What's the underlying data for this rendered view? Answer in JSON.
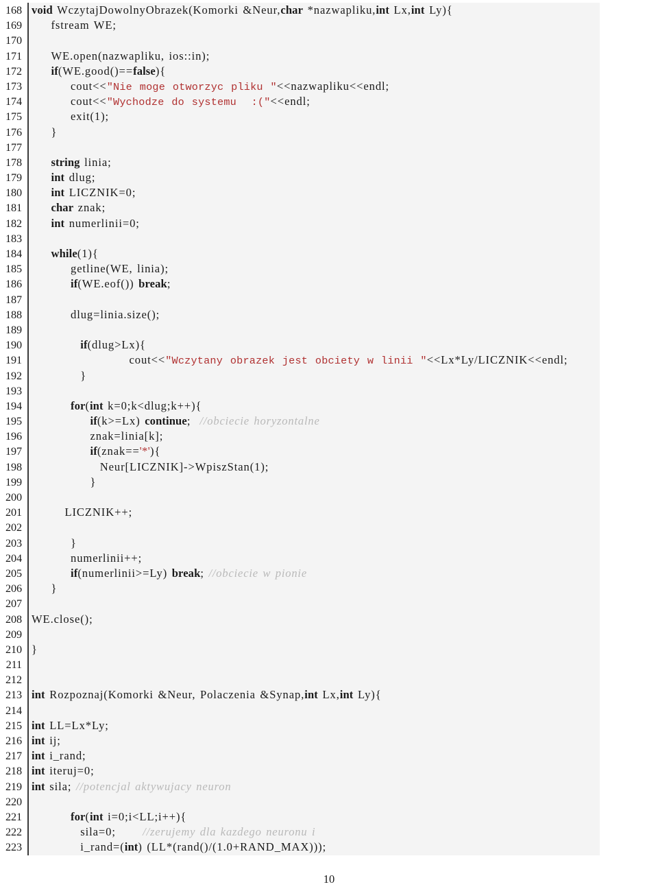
{
  "document": {
    "type": "code-listing",
    "language": "C++",
    "page_number": "10",
    "first_line_number": 168,
    "last_line_number": 223,
    "colors": {
      "background": "#f4f4f4",
      "text": "#1a1a1a",
      "string": "#b03030",
      "comment": "#b9b9b9",
      "rule": "#3a3a3a"
    }
  },
  "lines": [
    {
      "n": "168",
      "indent": 0,
      "tokens": [
        {
          "t": "kw",
          "v": "void"
        },
        {
          "t": "id",
          "v": " WczytajDowolnyObrazek(Komorki &Neur,"
        },
        {
          "t": "kw",
          "v": "char"
        },
        {
          "t": "id",
          "v": " *nazwapliku,"
        },
        {
          "t": "kw",
          "v": "int"
        },
        {
          "t": "id",
          "v": " Lx,"
        },
        {
          "t": "kw",
          "v": "int"
        },
        {
          "t": "id",
          "v": " Ly){"
        }
      ]
    },
    {
      "n": "169",
      "indent": 1,
      "tokens": [
        {
          "t": "id",
          "v": "fstream WE;"
        }
      ]
    },
    {
      "n": "170",
      "indent": 0,
      "tokens": []
    },
    {
      "n": "171",
      "indent": 1,
      "tokens": [
        {
          "t": "id",
          "v": "WE.open(nazwapliku, ios::in);"
        }
      ]
    },
    {
      "n": "172",
      "indent": 1,
      "tokens": [
        {
          "t": "kw",
          "v": "if"
        },
        {
          "t": "id",
          "v": "(WE.good()=="
        },
        {
          "t": "kw",
          "v": "false"
        },
        {
          "t": "id",
          "v": "){"
        }
      ]
    },
    {
      "n": "173",
      "indent": 2,
      "tokens": [
        {
          "t": "id",
          "v": "cout<<"
        },
        {
          "t": "str",
          "v": "\"Nie moge otworzyc pliku \""
        },
        {
          "t": "id",
          "v": "<<nazwapliku<<endl;"
        }
      ]
    },
    {
      "n": "174",
      "indent": 2,
      "tokens": [
        {
          "t": "id",
          "v": "cout<<"
        },
        {
          "t": "str",
          "v": "\"Wychodze do systemu  :(\""
        },
        {
          "t": "id",
          "v": "<<endl;"
        }
      ]
    },
    {
      "n": "175",
      "indent": 2,
      "tokens": [
        {
          "t": "id",
          "v": "exit(1);"
        }
      ]
    },
    {
      "n": "176",
      "indent": 1,
      "tokens": [
        {
          "t": "id",
          "v": "}"
        }
      ]
    },
    {
      "n": "177",
      "indent": 0,
      "tokens": []
    },
    {
      "n": "178",
      "indent": 1,
      "tokens": [
        {
          "t": "kw",
          "v": "string"
        },
        {
          "t": "id",
          "v": " linia;"
        }
      ]
    },
    {
      "n": "179",
      "indent": 1,
      "tokens": [
        {
          "t": "kw",
          "v": "int"
        },
        {
          "t": "id",
          "v": " dlug;"
        }
      ]
    },
    {
      "n": "180",
      "indent": 1,
      "tokens": [
        {
          "t": "kw",
          "v": "int"
        },
        {
          "t": "id",
          "v": " LICZNIK=0;"
        }
      ]
    },
    {
      "n": "181",
      "indent": 1,
      "tokens": [
        {
          "t": "kw",
          "v": "char"
        },
        {
          "t": "id",
          "v": " znak;"
        }
      ]
    },
    {
      "n": "182",
      "indent": 1,
      "tokens": [
        {
          "t": "kw",
          "v": "int"
        },
        {
          "t": "id",
          "v": " numerlinii=0;"
        }
      ]
    },
    {
      "n": "183",
      "indent": 0,
      "tokens": []
    },
    {
      "n": "184",
      "indent": 1,
      "tokens": [
        {
          "t": "kw",
          "v": "while"
        },
        {
          "t": "id",
          "v": "(1){"
        }
      ]
    },
    {
      "n": "185",
      "indent": 2,
      "tokens": [
        {
          "t": "id",
          "v": "getline(WE, linia);"
        }
      ]
    },
    {
      "n": "186",
      "indent": 2,
      "tokens": [
        {
          "t": "kw",
          "v": "if"
        },
        {
          "t": "id",
          "v": "(WE.eof()) "
        },
        {
          "t": "kw",
          "v": "break"
        },
        {
          "t": "id",
          "v": ";"
        }
      ]
    },
    {
      "n": "187",
      "indent": 0,
      "tokens": []
    },
    {
      "n": "188",
      "indent": 2,
      "tokens": [
        {
          "t": "id",
          "v": "dlug=linia.size();"
        }
      ]
    },
    {
      "n": "189",
      "indent": 0,
      "tokens": []
    },
    {
      "n": "190",
      "indent": 2.5,
      "tokens": [
        {
          "t": "kw",
          "v": "if"
        },
        {
          "t": "id",
          "v": "(dlug>Lx){"
        }
      ]
    },
    {
      "n": "191",
      "indent": 5,
      "tokens": [
        {
          "t": "id",
          "v": "cout<<"
        },
        {
          "t": "str",
          "v": "\"Wczytany obrazek jest obciety w linii \""
        },
        {
          "t": "id",
          "v": "<<Lx*Ly/LICZNIK<<endl;"
        }
      ]
    },
    {
      "n": "192",
      "indent": 2.5,
      "tokens": [
        {
          "t": "id",
          "v": "}"
        }
      ]
    },
    {
      "n": "193",
      "indent": 0,
      "tokens": []
    },
    {
      "n": "194",
      "indent": 2,
      "tokens": [
        {
          "t": "kw",
          "v": "for"
        },
        {
          "t": "id",
          "v": "("
        },
        {
          "t": "kw",
          "v": "int"
        },
        {
          "t": "id",
          "v": " k=0;k<dlug;k++){"
        }
      ]
    },
    {
      "n": "195",
      "indent": 3,
      "tokens": [
        {
          "t": "kw",
          "v": "if"
        },
        {
          "t": "id",
          "v": "(k>=Lx) "
        },
        {
          "t": "kw",
          "v": "continue"
        },
        {
          "t": "id",
          "v": ";  "
        },
        {
          "t": "cmt",
          "v": "//obciecie horyzontalne"
        }
      ]
    },
    {
      "n": "196",
      "indent": 3,
      "tokens": [
        {
          "t": "id",
          "v": "znak=linia[k];"
        }
      ]
    },
    {
      "n": "197",
      "indent": 3,
      "tokens": [
        {
          "t": "kw",
          "v": "if"
        },
        {
          "t": "id",
          "v": "(znak=="
        },
        {
          "t": "chr",
          "v": "'*'"
        },
        {
          "t": "id",
          "v": "){"
        }
      ]
    },
    {
      "n": "198",
      "indent": 3.5,
      "tokens": [
        {
          "t": "id",
          "v": "Neur[LICZNIK]->WpiszStan(1);"
        }
      ]
    },
    {
      "n": "199",
      "indent": 3,
      "tokens": [
        {
          "t": "id",
          "v": "}"
        }
      ]
    },
    {
      "n": "200",
      "indent": 0,
      "tokens": []
    },
    {
      "n": "201",
      "indent": 1.7,
      "tokens": [
        {
          "t": "id",
          "v": "LICZNIK++;"
        }
      ]
    },
    {
      "n": "202",
      "indent": 0,
      "tokens": []
    },
    {
      "n": "203",
      "indent": 2,
      "tokens": [
        {
          "t": "id",
          "v": "}"
        }
      ]
    },
    {
      "n": "204",
      "indent": 2,
      "tokens": [
        {
          "t": "id",
          "v": "numerlinii++;"
        }
      ]
    },
    {
      "n": "205",
      "indent": 2,
      "tokens": [
        {
          "t": "kw",
          "v": "if"
        },
        {
          "t": "id",
          "v": "(numerlinii>=Ly) "
        },
        {
          "t": "kw",
          "v": "break"
        },
        {
          "t": "id",
          "v": "; "
        },
        {
          "t": "cmt",
          "v": "//obciecie w pionie"
        }
      ]
    },
    {
      "n": "206",
      "indent": 1,
      "tokens": [
        {
          "t": "id",
          "v": "}"
        }
      ]
    },
    {
      "n": "207",
      "indent": 0,
      "tokens": []
    },
    {
      "n": "208",
      "indent": 0,
      "tokens": [
        {
          "t": "id",
          "v": "WE.close();"
        }
      ]
    },
    {
      "n": "209",
      "indent": 0,
      "tokens": []
    },
    {
      "n": "210",
      "indent": 0,
      "tokens": [
        {
          "t": "id",
          "v": "}"
        }
      ]
    },
    {
      "n": "211",
      "indent": 0,
      "tokens": []
    },
    {
      "n": "212",
      "indent": 0,
      "tokens": []
    },
    {
      "n": "213",
      "indent": 0,
      "tokens": [
        {
          "t": "kw",
          "v": "int"
        },
        {
          "t": "id",
          "v": " Rozpoznaj(Komorki &Neur, Polaczenia &Synap,"
        },
        {
          "t": "kw",
          "v": "int"
        },
        {
          "t": "id",
          "v": " Lx,"
        },
        {
          "t": "kw",
          "v": "int"
        },
        {
          "t": "id",
          "v": " Ly){"
        }
      ]
    },
    {
      "n": "214",
      "indent": 0,
      "tokens": []
    },
    {
      "n": "215",
      "indent": 0,
      "tokens": [
        {
          "t": "kw",
          "v": "int"
        },
        {
          "t": "id",
          "v": " LL=Lx*Ly;"
        }
      ]
    },
    {
      "n": "216",
      "indent": 0,
      "tokens": [
        {
          "t": "kw",
          "v": "int"
        },
        {
          "t": "id",
          "v": " ij;"
        }
      ]
    },
    {
      "n": "217",
      "indent": 0,
      "tokens": [
        {
          "t": "kw",
          "v": "int"
        },
        {
          "t": "id",
          "v": " i_rand;"
        }
      ]
    },
    {
      "n": "218",
      "indent": 0,
      "tokens": [
        {
          "t": "kw",
          "v": "int"
        },
        {
          "t": "id",
          "v": " iteruj=0;"
        }
      ]
    },
    {
      "n": "219",
      "indent": 0,
      "tokens": [
        {
          "t": "kw",
          "v": "int"
        },
        {
          "t": "id",
          "v": " sila; "
        },
        {
          "t": "cmt",
          "v": "//potencjal aktywujacy neuron"
        }
      ]
    },
    {
      "n": "220",
      "indent": 0,
      "tokens": []
    },
    {
      "n": "221",
      "indent": 2,
      "tokens": [
        {
          "t": "kw",
          "v": "for"
        },
        {
          "t": "id",
          "v": "("
        },
        {
          "t": "kw",
          "v": "int"
        },
        {
          "t": "id",
          "v": " i=0;i<LL;i++){"
        }
      ]
    },
    {
      "n": "222",
      "indent": 2.5,
      "tokens": [
        {
          "t": "id",
          "v": "sila=0;      "
        },
        {
          "t": "cmt",
          "v": "//zerujemy dla kazdego neuronu i"
        }
      ]
    },
    {
      "n": "223",
      "indent": 2.5,
      "tokens": [
        {
          "t": "id",
          "v": "i_rand=("
        },
        {
          "t": "kw",
          "v": "int"
        },
        {
          "t": "id",
          "v": ") (LL*(rand()/(1.0+RAND_MAX)));"
        }
      ]
    }
  ],
  "folio": {
    "label": "10"
  }
}
